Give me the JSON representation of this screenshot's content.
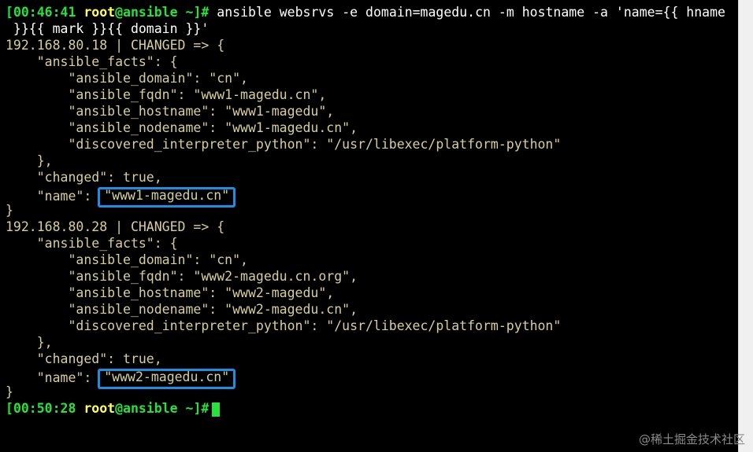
{
  "colors": {
    "background": "#000000",
    "prompt_green": "#26e33b",
    "prompt_user_yellow": "#ffff55",
    "output_text": "#d6cf9a",
    "command_white": "#ffffff",
    "highlight_box": "#1e8fe0"
  },
  "prompt1": {
    "bracket_open": "[",
    "time": "00:46:41",
    "user": "root",
    "at_host": "@ansible",
    "path": "~",
    "bracket_close": "]#",
    "command_line1": " ansible websrvs -e domain=magedu.cn -m hostname -a 'name={{ hname",
    "command_line2": " }}{{ mark }}{{ domain }}'"
  },
  "host1": {
    "header": "192.168.80.18 | CHANGED => {",
    "facts_open": "    \"ansible_facts\": {",
    "fact_domain": "        \"ansible_domain\": \"cn\",",
    "fact_fqdn": "        \"ansible_fqdn\": \"www1-magedu.cn\",",
    "fact_hostname": "        \"ansible_hostname\": \"www1-magedu\",",
    "fact_nodename": "        \"ansible_nodename\": \"www1-magedu.cn\",",
    "fact_interpreter": "        \"discovered_interpreter_python\": \"/usr/libexec/platform-python\"",
    "facts_close": "    },",
    "changed": "    \"changed\": true,",
    "name_key": "    \"name\": ",
    "name_value": "\"www1-magedu.cn\"",
    "close": "}"
  },
  "host2": {
    "header": "192.168.80.28 | CHANGED => {",
    "facts_open": "    \"ansible_facts\": {",
    "fact_domain": "        \"ansible_domain\": \"cn\",",
    "fact_fqdn": "        \"ansible_fqdn\": \"www2-magedu.cn.org\",",
    "fact_hostname": "        \"ansible_hostname\": \"www2-magedu\",",
    "fact_nodename": "        \"ansible_nodename\": \"www2-magedu.cn\",",
    "fact_interpreter": "        \"discovered_interpreter_python\": \"/usr/libexec/platform-python\"",
    "facts_close": "    },",
    "changed": "    \"changed\": true,",
    "name_key": "    \"name\": ",
    "name_value": "\"www2-magedu.cn\"",
    "close": "}"
  },
  "prompt2": {
    "bracket_open": "[",
    "time": "00:50:28",
    "user": "root",
    "at_host": "@ansible",
    "path": "~",
    "bracket_close": "]#"
  },
  "watermark": "@稀土掘金技术社区"
}
